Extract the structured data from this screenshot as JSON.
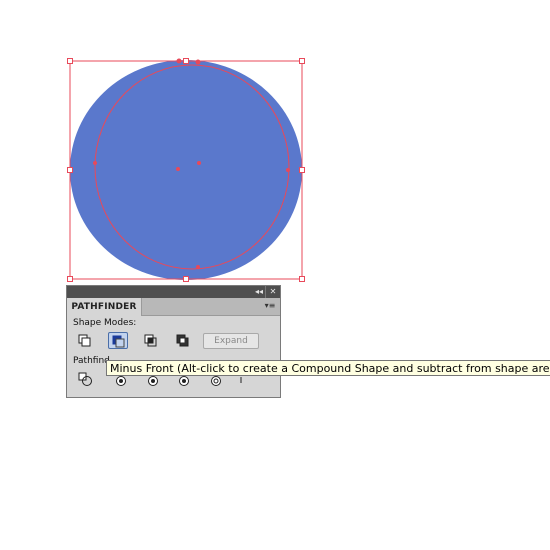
{
  "artboard": {
    "fill_color": "#5a78cc",
    "selection_color": "#e8495a"
  },
  "panel": {
    "collapse_icon": "double-chevron-left-icon",
    "collapse_glyph": "◂◂",
    "close_icon": "close-icon",
    "close_glyph": "✕",
    "tab_label": "PATHFINDER",
    "menu_icon": "panel-menu-icon",
    "menu_glyph": "▾≡",
    "shape_modes_label": "Shape Modes:",
    "pathfinders_label": "Pathfind",
    "expand_label": "Expand",
    "shape_mode_buttons": [
      "unite-icon",
      "minus-front-icon",
      "intersect-icon",
      "exclude-icon"
    ],
    "pathfinder_buttons": [
      "divide-icon",
      "trim-icon",
      "merge-icon",
      "crop-icon",
      "outline-icon",
      "minus-back-icon"
    ]
  },
  "tooltip": {
    "text": "Minus Front (Alt-click to create a Compound Shape and subtract from shape area)"
  }
}
